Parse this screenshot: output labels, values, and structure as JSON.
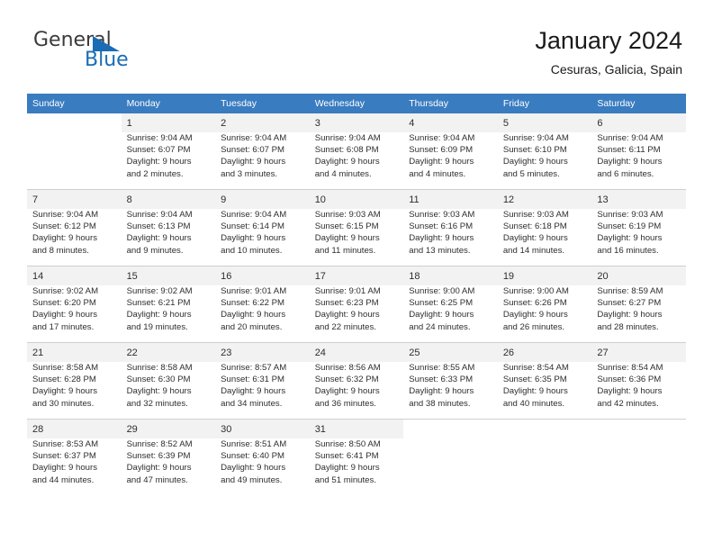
{
  "brand": {
    "name_part1": "General",
    "name_part2": "Blue",
    "triangle_icon": "triangle-icon",
    "accent_color": "#1a6cb5"
  },
  "header": {
    "title": "January 2024",
    "subtitle": "Cesuras, Galicia, Spain"
  },
  "theme": {
    "header_bar_color": "#3a7cc0",
    "row_band_color": "#f2f2f2",
    "grid_line_color": "#cfcfcf",
    "text_color": "#2e2e2e"
  },
  "weekday_headers": [
    "Sunday",
    "Monday",
    "Tuesday",
    "Wednesday",
    "Thursday",
    "Friday",
    "Saturday"
  ],
  "weeks": [
    [
      {
        "day": "",
        "sunrise": "",
        "sunset": "",
        "daylight_line1": "",
        "daylight_line2": ""
      },
      {
        "day": "1",
        "sunrise": "Sunrise: 9:04 AM",
        "sunset": "Sunset: 6:07 PM",
        "daylight_line1": "Daylight: 9 hours",
        "daylight_line2": "and 2 minutes."
      },
      {
        "day": "2",
        "sunrise": "Sunrise: 9:04 AM",
        "sunset": "Sunset: 6:07 PM",
        "daylight_line1": "Daylight: 9 hours",
        "daylight_line2": "and 3 minutes."
      },
      {
        "day": "3",
        "sunrise": "Sunrise: 9:04 AM",
        "sunset": "Sunset: 6:08 PM",
        "daylight_line1": "Daylight: 9 hours",
        "daylight_line2": "and 4 minutes."
      },
      {
        "day": "4",
        "sunrise": "Sunrise: 9:04 AM",
        "sunset": "Sunset: 6:09 PM",
        "daylight_line1": "Daylight: 9 hours",
        "daylight_line2": "and 4 minutes."
      },
      {
        "day": "5",
        "sunrise": "Sunrise: 9:04 AM",
        "sunset": "Sunset: 6:10 PM",
        "daylight_line1": "Daylight: 9 hours",
        "daylight_line2": "and 5 minutes."
      },
      {
        "day": "6",
        "sunrise": "Sunrise: 9:04 AM",
        "sunset": "Sunset: 6:11 PM",
        "daylight_line1": "Daylight: 9 hours",
        "daylight_line2": "and 6 minutes."
      }
    ],
    [
      {
        "day": "7",
        "sunrise": "Sunrise: 9:04 AM",
        "sunset": "Sunset: 6:12 PM",
        "daylight_line1": "Daylight: 9 hours",
        "daylight_line2": "and 8 minutes."
      },
      {
        "day": "8",
        "sunrise": "Sunrise: 9:04 AM",
        "sunset": "Sunset: 6:13 PM",
        "daylight_line1": "Daylight: 9 hours",
        "daylight_line2": "and 9 minutes."
      },
      {
        "day": "9",
        "sunrise": "Sunrise: 9:04 AM",
        "sunset": "Sunset: 6:14 PM",
        "daylight_line1": "Daylight: 9 hours",
        "daylight_line2": "and 10 minutes."
      },
      {
        "day": "10",
        "sunrise": "Sunrise: 9:03 AM",
        "sunset": "Sunset: 6:15 PM",
        "daylight_line1": "Daylight: 9 hours",
        "daylight_line2": "and 11 minutes."
      },
      {
        "day": "11",
        "sunrise": "Sunrise: 9:03 AM",
        "sunset": "Sunset: 6:16 PM",
        "daylight_line1": "Daylight: 9 hours",
        "daylight_line2": "and 13 minutes."
      },
      {
        "day": "12",
        "sunrise": "Sunrise: 9:03 AM",
        "sunset": "Sunset: 6:18 PM",
        "daylight_line1": "Daylight: 9 hours",
        "daylight_line2": "and 14 minutes."
      },
      {
        "day": "13",
        "sunrise": "Sunrise: 9:03 AM",
        "sunset": "Sunset: 6:19 PM",
        "daylight_line1": "Daylight: 9 hours",
        "daylight_line2": "and 16 minutes."
      }
    ],
    [
      {
        "day": "14",
        "sunrise": "Sunrise: 9:02 AM",
        "sunset": "Sunset: 6:20 PM",
        "daylight_line1": "Daylight: 9 hours",
        "daylight_line2": "and 17 minutes."
      },
      {
        "day": "15",
        "sunrise": "Sunrise: 9:02 AM",
        "sunset": "Sunset: 6:21 PM",
        "daylight_line1": "Daylight: 9 hours",
        "daylight_line2": "and 19 minutes."
      },
      {
        "day": "16",
        "sunrise": "Sunrise: 9:01 AM",
        "sunset": "Sunset: 6:22 PM",
        "daylight_line1": "Daylight: 9 hours",
        "daylight_line2": "and 20 minutes."
      },
      {
        "day": "17",
        "sunrise": "Sunrise: 9:01 AM",
        "sunset": "Sunset: 6:23 PM",
        "daylight_line1": "Daylight: 9 hours",
        "daylight_line2": "and 22 minutes."
      },
      {
        "day": "18",
        "sunrise": "Sunrise: 9:00 AM",
        "sunset": "Sunset: 6:25 PM",
        "daylight_line1": "Daylight: 9 hours",
        "daylight_line2": "and 24 minutes."
      },
      {
        "day": "19",
        "sunrise": "Sunrise: 9:00 AM",
        "sunset": "Sunset: 6:26 PM",
        "daylight_line1": "Daylight: 9 hours",
        "daylight_line2": "and 26 minutes."
      },
      {
        "day": "20",
        "sunrise": "Sunrise: 8:59 AM",
        "sunset": "Sunset: 6:27 PM",
        "daylight_line1": "Daylight: 9 hours",
        "daylight_line2": "and 28 minutes."
      }
    ],
    [
      {
        "day": "21",
        "sunrise": "Sunrise: 8:58 AM",
        "sunset": "Sunset: 6:28 PM",
        "daylight_line1": "Daylight: 9 hours",
        "daylight_line2": "and 30 minutes."
      },
      {
        "day": "22",
        "sunrise": "Sunrise: 8:58 AM",
        "sunset": "Sunset: 6:30 PM",
        "daylight_line1": "Daylight: 9 hours",
        "daylight_line2": "and 32 minutes."
      },
      {
        "day": "23",
        "sunrise": "Sunrise: 8:57 AM",
        "sunset": "Sunset: 6:31 PM",
        "daylight_line1": "Daylight: 9 hours",
        "daylight_line2": "and 34 minutes."
      },
      {
        "day": "24",
        "sunrise": "Sunrise: 8:56 AM",
        "sunset": "Sunset: 6:32 PM",
        "daylight_line1": "Daylight: 9 hours",
        "daylight_line2": "and 36 minutes."
      },
      {
        "day": "25",
        "sunrise": "Sunrise: 8:55 AM",
        "sunset": "Sunset: 6:33 PM",
        "daylight_line1": "Daylight: 9 hours",
        "daylight_line2": "and 38 minutes."
      },
      {
        "day": "26",
        "sunrise": "Sunrise: 8:54 AM",
        "sunset": "Sunset: 6:35 PM",
        "daylight_line1": "Daylight: 9 hours",
        "daylight_line2": "and 40 minutes."
      },
      {
        "day": "27",
        "sunrise": "Sunrise: 8:54 AM",
        "sunset": "Sunset: 6:36 PM",
        "daylight_line1": "Daylight: 9 hours",
        "daylight_line2": "and 42 minutes."
      }
    ],
    [
      {
        "day": "28",
        "sunrise": "Sunrise: 8:53 AM",
        "sunset": "Sunset: 6:37 PM",
        "daylight_line1": "Daylight: 9 hours",
        "daylight_line2": "and 44 minutes."
      },
      {
        "day": "29",
        "sunrise": "Sunrise: 8:52 AM",
        "sunset": "Sunset: 6:39 PM",
        "daylight_line1": "Daylight: 9 hours",
        "daylight_line2": "and 47 minutes."
      },
      {
        "day": "30",
        "sunrise": "Sunrise: 8:51 AM",
        "sunset": "Sunset: 6:40 PM",
        "daylight_line1": "Daylight: 9 hours",
        "daylight_line2": "and 49 minutes."
      },
      {
        "day": "31",
        "sunrise": "Sunrise: 8:50 AM",
        "sunset": "Sunset: 6:41 PM",
        "daylight_line1": "Daylight: 9 hours",
        "daylight_line2": "and 51 minutes."
      },
      {
        "day": "",
        "sunrise": "",
        "sunset": "",
        "daylight_line1": "",
        "daylight_line2": ""
      },
      {
        "day": "",
        "sunrise": "",
        "sunset": "",
        "daylight_line1": "",
        "daylight_line2": ""
      },
      {
        "day": "",
        "sunrise": "",
        "sunset": "",
        "daylight_line1": "",
        "daylight_line2": ""
      }
    ]
  ]
}
